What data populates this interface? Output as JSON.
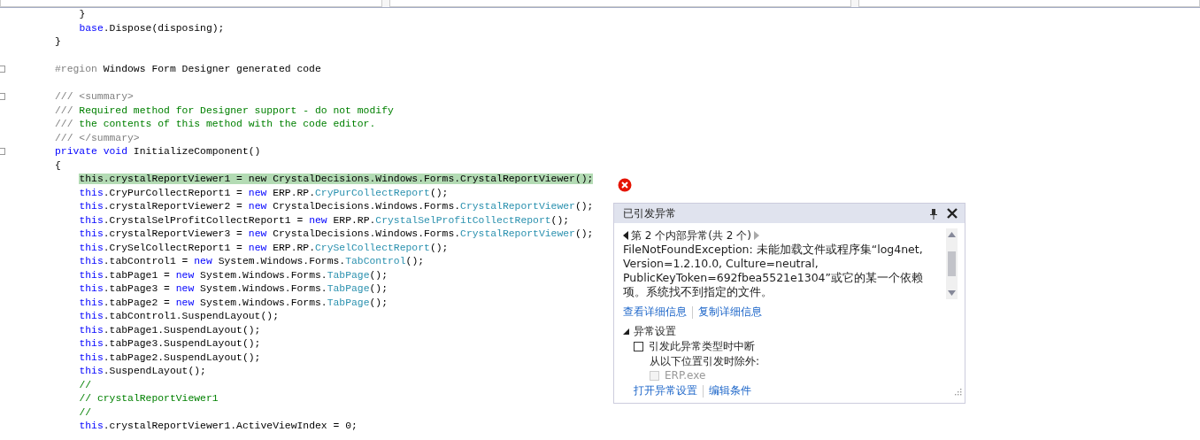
{
  "code_lines": [
    {
      "fold": false,
      "highlighted": false,
      "indented": true,
      "tokens": [
        {
          "kind": "plain",
          "text": "}"
        }
      ]
    },
    {
      "fold": false,
      "highlighted": false,
      "indented": true,
      "tokens": [
        {
          "kind": "keyword",
          "text": "base"
        },
        {
          "kind": "plain",
          "text": ".Dispose(disposing);"
        }
      ]
    },
    {
      "fold": false,
      "highlighted": false,
      "indented": false,
      "tokens": [
        {
          "kind": "plain",
          "text": "}"
        }
      ]
    },
    {
      "fold": false,
      "highlighted": false
    },
    {
      "fold": true,
      "highlighted": false,
      "indented": false,
      "tokens": [
        {
          "kind": "gray",
          "text": "#region"
        },
        {
          "kind": "plain",
          "text": " Windows Form Designer generated code"
        }
      ]
    },
    {
      "fold": false,
      "highlighted": false
    },
    {
      "fold": true,
      "highlighted": false,
      "indented": false,
      "tokens": [
        {
          "kind": "gray",
          "text": "/// <summary>"
        }
      ]
    },
    {
      "fold": false,
      "highlighted": false,
      "indented": false,
      "tokens": [
        {
          "kind": "gray",
          "text": "///"
        },
        {
          "kind": "comment",
          "text": " Required method for Designer support - do not modify"
        }
      ]
    },
    {
      "fold": false,
      "highlighted": false,
      "indented": false,
      "tokens": [
        {
          "kind": "gray",
          "text": "///"
        },
        {
          "kind": "comment",
          "text": " the contents of this method with the code editor."
        }
      ]
    },
    {
      "fold": false,
      "highlighted": false,
      "indented": false,
      "tokens": [
        {
          "kind": "gray",
          "text": "/// </summary>"
        }
      ]
    },
    {
      "fold": true,
      "highlighted": false,
      "indented": false,
      "tokens": [
        {
          "kind": "keyword",
          "text": "private void"
        },
        {
          "kind": "plain",
          "text": " InitializeComponent()"
        }
      ]
    },
    {
      "fold": false,
      "highlighted": false,
      "indented": false,
      "tokens": [
        {
          "kind": "plain",
          "text": "{"
        }
      ]
    },
    {
      "fold": false,
      "highlighted": true,
      "indented": true,
      "tokens": [
        {
          "kind": "keyword",
          "text": "this"
        },
        {
          "kind": "plain",
          "text": ".crystalReportViewer1 = "
        },
        {
          "kind": "keyword",
          "text": "new"
        },
        {
          "kind": "plain",
          "text": " CrystalDecisions.Windows.Forms."
        },
        {
          "kind": "type",
          "text": "CrystalReportViewer"
        },
        {
          "kind": "plain",
          "text": "();"
        }
      ]
    },
    {
      "fold": false,
      "highlighted": false,
      "indented": true,
      "tokens": [
        {
          "kind": "keyword",
          "text": "this"
        },
        {
          "kind": "plain",
          "text": ".CryPurCollectReport1 = "
        },
        {
          "kind": "keyword",
          "text": "new"
        },
        {
          "kind": "plain",
          "text": " ERP.RP."
        },
        {
          "kind": "type",
          "text": "CryPurCollectReport"
        },
        {
          "kind": "plain",
          "text": "();"
        }
      ]
    },
    {
      "fold": false,
      "highlighted": false,
      "indented": true,
      "tokens": [
        {
          "kind": "keyword",
          "text": "this"
        },
        {
          "kind": "plain",
          "text": ".crystalReportViewer2 = "
        },
        {
          "kind": "keyword",
          "text": "new"
        },
        {
          "kind": "plain",
          "text": " CrystalDecisions.Windows.Forms."
        },
        {
          "kind": "type",
          "text": "CrystalReportViewer"
        },
        {
          "kind": "plain",
          "text": "();"
        }
      ]
    },
    {
      "fold": false,
      "highlighted": false,
      "indented": true,
      "tokens": [
        {
          "kind": "keyword",
          "text": "this"
        },
        {
          "kind": "plain",
          "text": ".CrystalSelProfitCollectReport1 = "
        },
        {
          "kind": "keyword",
          "text": "new"
        },
        {
          "kind": "plain",
          "text": " ERP.RP."
        },
        {
          "kind": "type",
          "text": "CrystalSelProfitCollectReport"
        },
        {
          "kind": "plain",
          "text": "();"
        }
      ]
    },
    {
      "fold": false,
      "highlighted": false,
      "indented": true,
      "tokens": [
        {
          "kind": "keyword",
          "text": "this"
        },
        {
          "kind": "plain",
          "text": ".crystalReportViewer3 = "
        },
        {
          "kind": "keyword",
          "text": "new"
        },
        {
          "kind": "plain",
          "text": " CrystalDecisions.Windows.Forms."
        },
        {
          "kind": "type",
          "text": "CrystalReportViewer"
        },
        {
          "kind": "plain",
          "text": "();"
        }
      ]
    },
    {
      "fold": false,
      "highlighted": false,
      "indented": true,
      "tokens": [
        {
          "kind": "keyword",
          "text": "this"
        },
        {
          "kind": "plain",
          "text": ".CrySelCollectReport1 = "
        },
        {
          "kind": "keyword",
          "text": "new"
        },
        {
          "kind": "plain",
          "text": " ERP.RP."
        },
        {
          "kind": "type",
          "text": "CrySelCollectReport"
        },
        {
          "kind": "plain",
          "text": "();"
        }
      ]
    },
    {
      "fold": false,
      "highlighted": false,
      "indented": true,
      "tokens": [
        {
          "kind": "keyword",
          "text": "this"
        },
        {
          "kind": "plain",
          "text": ".tabControl1 = "
        },
        {
          "kind": "keyword",
          "text": "new"
        },
        {
          "kind": "plain",
          "text": " System.Windows.Forms."
        },
        {
          "kind": "type",
          "text": "TabControl"
        },
        {
          "kind": "plain",
          "text": "();"
        }
      ]
    },
    {
      "fold": false,
      "highlighted": false,
      "indented": true,
      "tokens": [
        {
          "kind": "keyword",
          "text": "this"
        },
        {
          "kind": "plain",
          "text": ".tabPage1 = "
        },
        {
          "kind": "keyword",
          "text": "new"
        },
        {
          "kind": "plain",
          "text": " System.Windows.Forms."
        },
        {
          "kind": "type",
          "text": "TabPage"
        },
        {
          "kind": "plain",
          "text": "();"
        }
      ]
    },
    {
      "fold": false,
      "highlighted": false,
      "indented": true,
      "tokens": [
        {
          "kind": "keyword",
          "text": "this"
        },
        {
          "kind": "plain",
          "text": ".tabPage3 = "
        },
        {
          "kind": "keyword",
          "text": "new"
        },
        {
          "kind": "plain",
          "text": " System.Windows.Forms."
        },
        {
          "kind": "type",
          "text": "TabPage"
        },
        {
          "kind": "plain",
          "text": "();"
        }
      ]
    },
    {
      "fold": false,
      "highlighted": false,
      "indented": true,
      "tokens": [
        {
          "kind": "keyword",
          "text": "this"
        },
        {
          "kind": "plain",
          "text": ".tabPage2 = "
        },
        {
          "kind": "keyword",
          "text": "new"
        },
        {
          "kind": "plain",
          "text": " System.Windows.Forms."
        },
        {
          "kind": "type",
          "text": "TabPage"
        },
        {
          "kind": "plain",
          "text": "();"
        }
      ]
    },
    {
      "fold": false,
      "highlighted": false,
      "indented": true,
      "tokens": [
        {
          "kind": "keyword",
          "text": "this"
        },
        {
          "kind": "plain",
          "text": ".tabControl1.SuspendLayout();"
        }
      ]
    },
    {
      "fold": false,
      "highlighted": false,
      "indented": true,
      "tokens": [
        {
          "kind": "keyword",
          "text": "this"
        },
        {
          "kind": "plain",
          "text": ".tabPage1.SuspendLayout();"
        }
      ]
    },
    {
      "fold": false,
      "highlighted": false,
      "indented": true,
      "tokens": [
        {
          "kind": "keyword",
          "text": "this"
        },
        {
          "kind": "plain",
          "text": ".tabPage3.SuspendLayout();"
        }
      ]
    },
    {
      "fold": false,
      "highlighted": false,
      "indented": true,
      "tokens": [
        {
          "kind": "keyword",
          "text": "this"
        },
        {
          "kind": "plain",
          "text": ".tabPage2.SuspendLayout();"
        }
      ]
    },
    {
      "fold": false,
      "highlighted": false,
      "indented": true,
      "tokens": [
        {
          "kind": "keyword",
          "text": "this"
        },
        {
          "kind": "plain",
          "text": ".SuspendLayout();"
        }
      ]
    },
    {
      "fold": false,
      "highlighted": false,
      "indented": true,
      "tokens": [
        {
          "kind": "comment",
          "text": "//"
        }
      ]
    },
    {
      "fold": false,
      "highlighted": false,
      "indented": true,
      "tokens": [
        {
          "kind": "comment",
          "text": "// crystalReportViewer1"
        }
      ]
    },
    {
      "fold": false,
      "highlighted": false,
      "indented": true,
      "tokens": [
        {
          "kind": "comment",
          "text": "//"
        }
      ]
    },
    {
      "fold": false,
      "highlighted": false,
      "indented": true,
      "tokens": [
        {
          "kind": "keyword",
          "text": "this"
        },
        {
          "kind": "plain",
          "text": ".crystalReportViewer1.ActiveViewIndex = 0;"
        }
      ]
    }
  ],
  "exception_popup": {
    "title": "已引发异常",
    "inner_nav": "第 2 个内部异常(共 2 个)",
    "message": "FileNotFoundException: 未能加载文件或程序集“log4net, Version=1.2.10.0, Culture=neutral, PublicKeyToken=692fbea5521e1304”或它的某一个依赖项。系统找不到指定的文件。",
    "links": [
      "查看详细信息",
      "复制详细信息"
    ],
    "settings": {
      "title": "异常设置",
      "expanded": true,
      "break_option": {
        "label": "引发此异常类型时中断",
        "checked": false
      },
      "except_label": "从以下位置引发时除外:",
      "modules": [
        {
          "label": "ERP.exe",
          "checked": false,
          "disabled": true
        }
      ]
    },
    "footer_links": [
      "打开异常设置",
      "编辑条件"
    ]
  }
}
